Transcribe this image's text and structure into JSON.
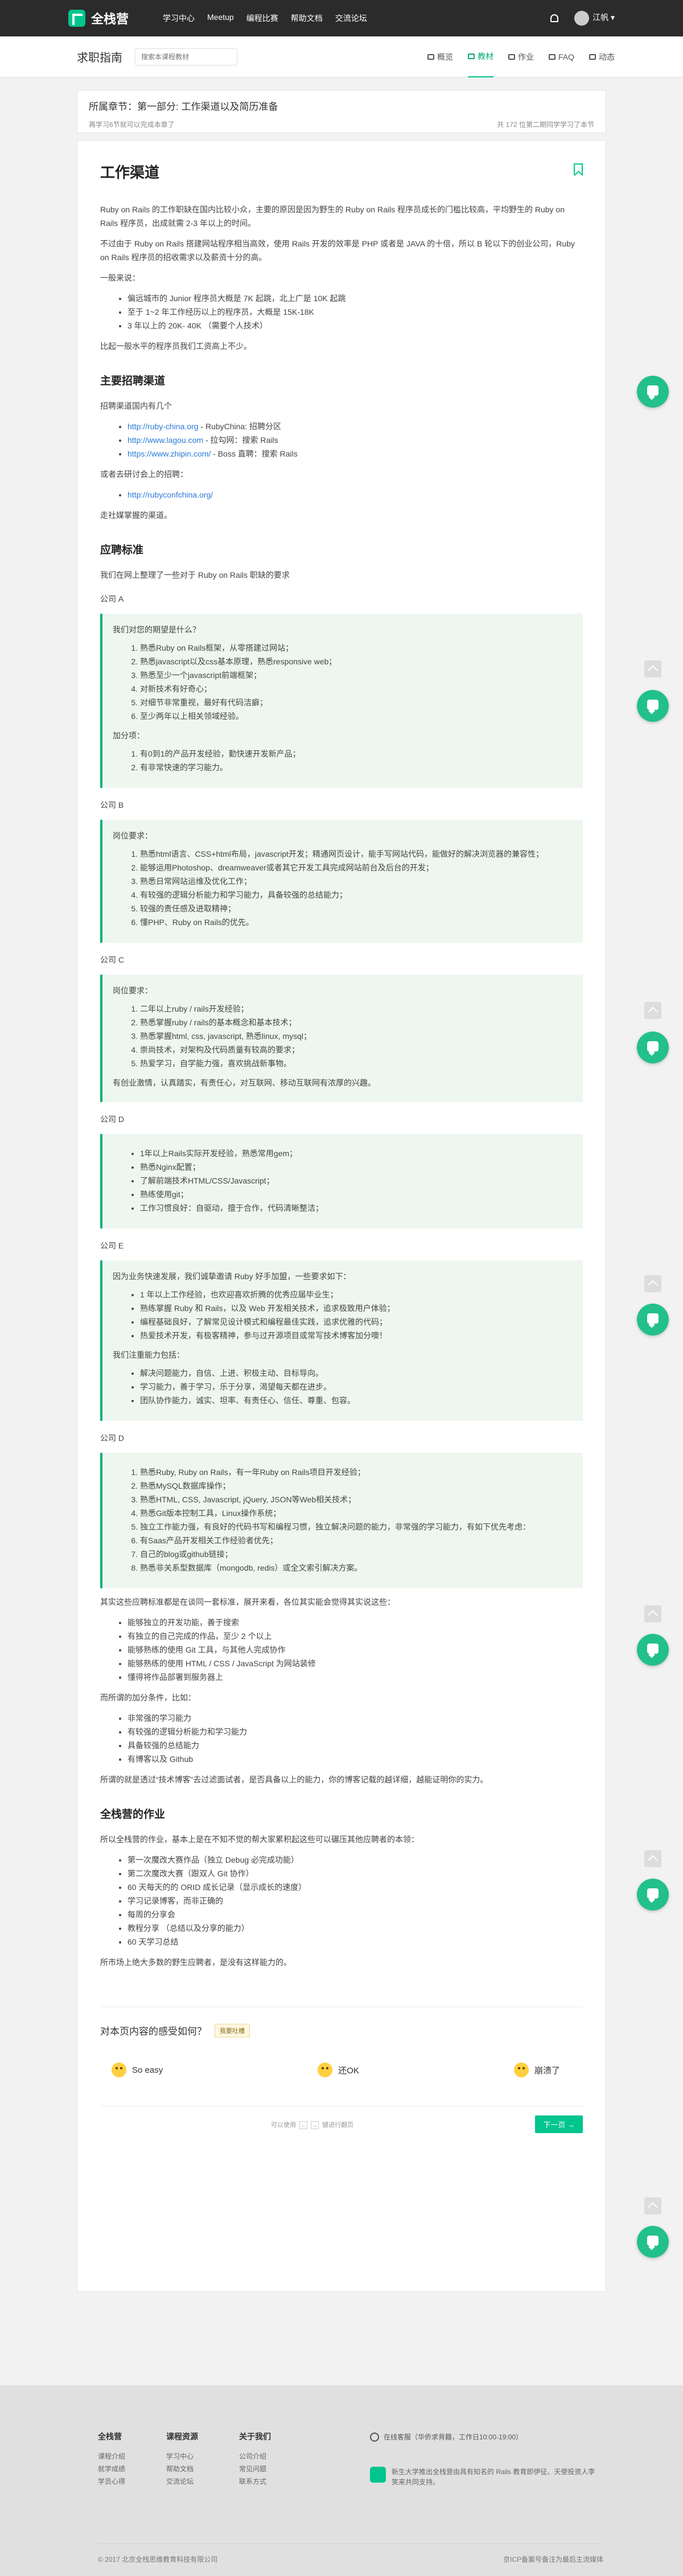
{
  "nav": {
    "brand": "全栈营",
    "links": [
      "学习中心",
      "Meetup",
      "编程比赛",
      "帮助文档",
      "交流论坛"
    ],
    "user": "江帆"
  },
  "subnav": {
    "title": "求职指南",
    "search_placeholder": "搜索本课程教材",
    "tabs": [
      "概览",
      "教材",
      "作业",
      "FAQ",
      "动态"
    ]
  },
  "chapter": {
    "title": "所属章节：第一部分: 工作渠道以及简历准备",
    "meta_left": "再学习6节就可以完成本章了",
    "meta_right": "共 172 位第二期同学学习了本节"
  },
  "article": {
    "title": "工作渠道",
    "intro": [
      "Ruby on Rails 的工作职缺在国内比较小众，主要的原因是因为野生的 Ruby on Rails 程序员成长的门槛比较高，平均野生的 Ruby on Rails 程序员，出成就需 2-3 年以上的时间。",
      "不过由于 Ruby on Rails 搭建网站程序相当高效，使用 Rails 开发的效率是 PHP 或者是 JAVA 的十倍，所以 B 轮以下的创业公司，Ruby on Rails 程序员的招收需求以及薪资十分的高。",
      "一般来说："
    ],
    "salary_list": [
      "偏远城市的 Junior 程序员大概是 7K 起跳，北上广是 10K 起跳",
      "至于 1~2 年工作经历以上的程序员，大概是 15K-18K",
      "3 年以上的 20K- 40K （需要个人技术）"
    ],
    "salary_note": "比起一般水平的程序员我们工资高上不少。",
    "channels_title": "主要招聘渠道",
    "channels_intro": "招聘渠道国内有几个",
    "channels": [
      {
        "url": "http://ruby-china.org",
        "desc": "- RubyChina: 招聘分区"
      },
      {
        "url": "http://www.lagou.com",
        "desc": "- 拉勾网：搜索 Rails"
      },
      {
        "url": "https://www.zhipin.com/",
        "desc": "- Boss 直聘：搜索 Rails"
      }
    ],
    "conf_intro": "或者去研讨会上的招聘：",
    "conf_url": "http://rubyconfchina.org/",
    "conf_note": "走社媒掌握的渠道。",
    "req_title": "应聘标准",
    "req_intro": "我们在网上整理了一些对于 Ruby on Rails 职缺的要求",
    "companyA": {
      "label": "公司 A",
      "q": "我们对您的期望是什么？",
      "items": [
        "熟悉Ruby on Rails框架，从零搭建过网站；",
        "熟悉javascript以及css基本原理，熟悉responsive web；",
        "熟悉至少一个javascript前端框架；",
        "对新技术有好奇心；",
        "对细节非常重视，最好有代码洁癖；",
        "至少两年以上相关领域经验。"
      ],
      "bonus_label": "加分项：",
      "bonus": [
        "有0到1的产品开发经验，勤快速开发新产品；",
        "有非常快速的学习能力。"
      ]
    },
    "companyB": {
      "label": "公司 B",
      "q": "岗位要求：",
      "items": [
        "熟悉html语言、CSS+html布局，javascript开发；精通网页设计，能手写网站代码，能做好的解决浏览器的兼容性；",
        "能够运用Photoshop、dreamweaver或者其它开发工具完成网站前台及后台的开发；",
        "熟悉日常网站运维及优化工作；",
        "有较强的逻辑分析能力和学习能力，具备较强的总结能力；",
        "较强的责任感及进取精神；",
        "懂PHP、Ruby on Rails的优先。"
      ]
    },
    "companyC": {
      "label": "公司 C",
      "q": "岗位要求：",
      "items": [
        "二年以上ruby / rails开发经验；",
        "熟悉掌握ruby / rails的基本概念和基本技术；",
        "熟悉掌握html, css, javascript, 熟悉linux, mysql；",
        "崇尚技术，对架构及代码质量有较高的要求；",
        "热爱学习，自学能力强，喜欢挑战新事物。"
      ],
      "note": "有创业激情，认真踏实，有责任心，对互联网、移动互联网有浓厚的兴趣。"
    },
    "companyD": {
      "label": "公司 D",
      "items": [
        "1年以上Rails实际开发经验，熟悉常用gem；",
        "熟悉Nginx配置；",
        "了解前端技术HTML/CSS/Javascript；",
        "熟练使用git；",
        "工作习惯良好：自驱动，擅于合作，代码清晰整洁；"
      ]
    },
    "companyE": {
      "label": "公司 E",
      "q": "因为业务快速发展，我们诚挚邀请 Ruby 好手加盟，一些要求如下：",
      "items": [
        "1 年以上工作经验，也欢迎喜欢折腾的优秀应届毕业生；",
        "熟练掌握 Ruby 和 Rails，以及 Web 开发相关技术，追求极致用户体验；",
        "编程基础良好，了解常见设计模式和编程最佳实践，追求优雅的代码；",
        "热爱技术开发，有极客精神，参与过开源项目或常写技术博客加分噢！"
      ],
      "q2": "我们注重能力包括：",
      "items2": [
        "解决问题能力，自信、上进、积极主动、目标导向。",
        "学习能力，善于学习，乐于分享，渴望每天都在进步。",
        "团队协作能力，诚实、坦率、有责任心、信任、尊重、包容。"
      ]
    },
    "companyD2": {
      "label": "公司 D",
      "items": [
        "熟悉Ruby, Ruby on Rails，有一年Ruby on Rails项目开发经验；",
        "熟悉MySQL数据库操作；",
        "熟悉HTML, CSS, Javascript, jQuery, JSON等Web相关技术；",
        "熟悉Git版本控制工具，Linux操作系统；",
        "独立工作能力强，有良好的代码书写和编程习惯，独立解决问题的能力，非常强的学习能力，有如下优先考虑：",
        "有Saas产品开发相关工作经验者优先；",
        "自己的blog或github链接；",
        "熟悉非关系型数据库（mongodb, redis）或全文索引解决方案。"
      ]
    },
    "summary_intro": "其实这些应聘标准都是在谈同一套标准，展开来看，各位其实能会觉得其实说这些：",
    "summary_list": [
      "能够独立的开发功能，善于搜索",
      "有独立的自己完成的作品，至少 2 个以上",
      "能够熟练的使用 Git 工具，与其他人完成协作",
      "能够熟练的使用 HTML / CSS / JavaScript 为网站装修",
      "懂得将作品部署到服务器上"
    ],
    "bonus_intro": "而所谓的加分条件，比如：",
    "bonus_list": [
      "非常强的学习能力",
      "有较强的逻辑分析能力和学习能力",
      "具备较强的总结能力",
      "有博客以及 Github"
    ],
    "bonus_note": "所谓的就是透过“技术博客”去过滤面试者，是否具备以上的能力，你的博客记载的越详细，越能证明你的实力。",
    "homework_title": "全栈营的作业",
    "homework_intro": "所以全栈营的作业，基本上是在不知不觉的帮大家累积起这些可以碾压其他应聘者的本领：",
    "homework_list": [
      "第一次魔改大赛作品（独立 Debug  必完成功能）",
      "第二次魔改大赛（跟双人 Git 协作）",
      "60 天每天的的 ORID 成长记录（显示成长的速度）",
      "学习记录博客，而非正确的",
      "每周的分享会",
      "教程分享   （总结以及分享的能力）",
      "60 天学习总结"
    ],
    "homework_note": "所市场上绝大多数的野生应聘者，是没有这样能力的。"
  },
  "feedback": {
    "question": "对本页内容的感受如何？",
    "chip": "我要吐槽",
    "options": [
      "So easy",
      "还OK",
      "崩溃了"
    ]
  },
  "article_footer": {
    "kbd_prefix": "可以使用",
    "kbd_suffix": "键进行翻页",
    "next": "下一页 →"
  },
  "footer": {
    "cols": [
      {
        "title": "全栈营",
        "items": [
          "课程介绍",
          "就学成绩",
          "学员心得"
        ]
      },
      {
        "title": "课程资源",
        "items": [
          "学习中心",
          "帮助文档",
          "交流论坛"
        ]
      },
      {
        "title": "关于我们",
        "items": [
          "公司介绍",
          "常见问题",
          "联系方式"
        ]
      }
    ],
    "hotline": "在线客服（华侨求背籍，工作日10:00-19:00）",
    "desc": "新生大学推出全栈营由具有知名的 Rails 教育即伊征、天使投资人李笑来共同支持。",
    "copyright": "© 2017 北京全栈思维教育科技有限公司",
    "icp": "京ICP备案号备注为最后主流媒体"
  }
}
